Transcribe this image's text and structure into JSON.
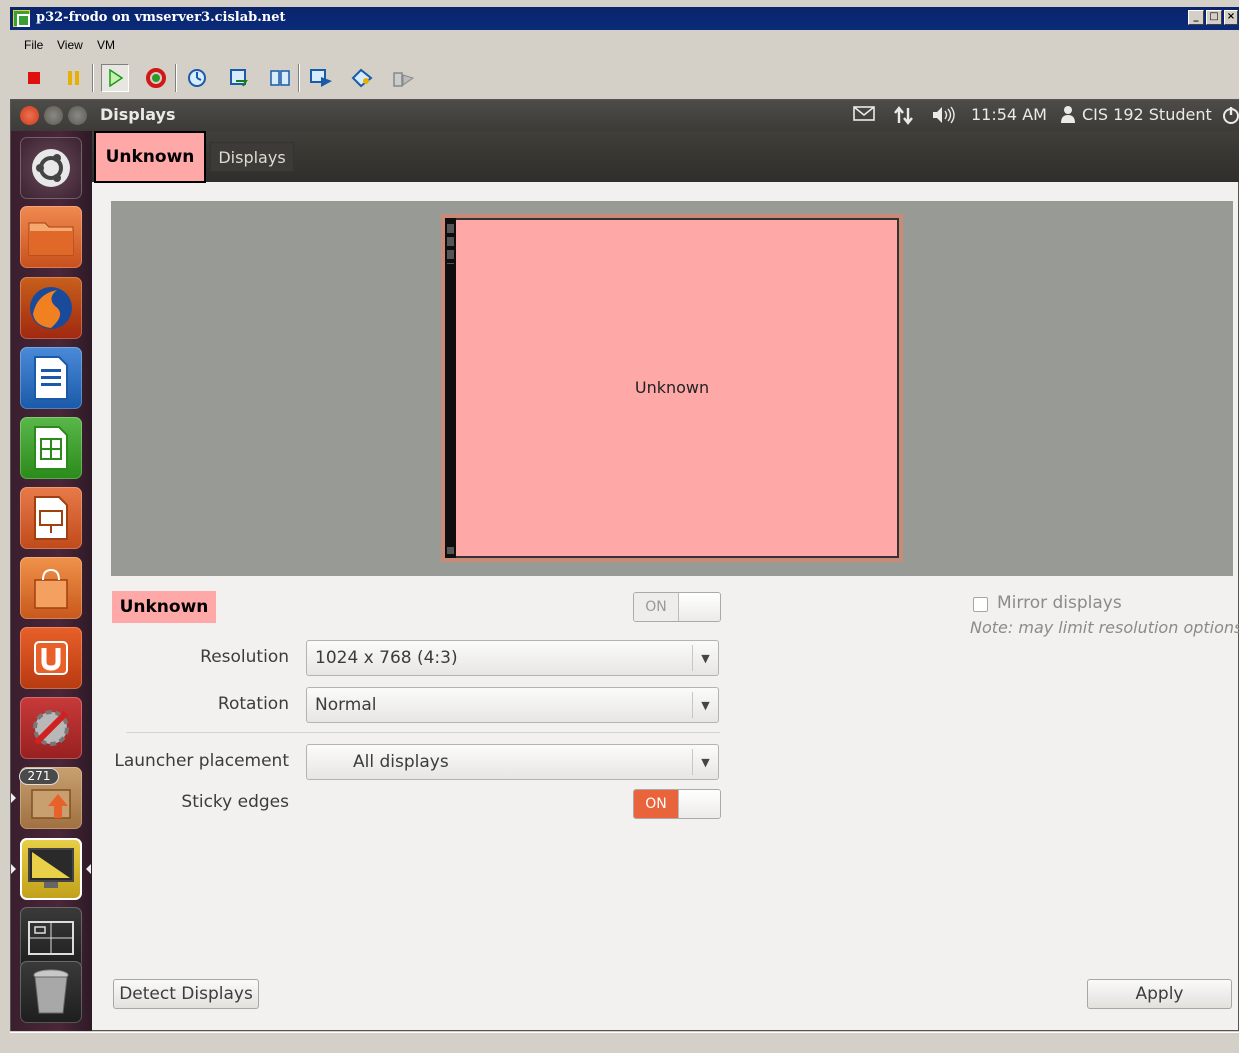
{
  "window": {
    "title": "p32-frodo on vmserver3.cislab.net"
  },
  "menubar": {
    "items": [
      "File",
      "View",
      "VM"
    ]
  },
  "toolbar": {
    "buttons": [
      "power-off",
      "suspend",
      "power-on",
      "reset",
      "snapshot",
      "revert-snapshot",
      "manage-snapshots",
      "full-screen",
      "quick-switch",
      "summary"
    ]
  },
  "guest": {
    "app_title": "Displays",
    "indicators": {
      "time": "11:54 AM",
      "user": "CIS 192 Student"
    },
    "launcher": {
      "badge_count": "271"
    },
    "tabs": [
      {
        "label": "Unknown"
      },
      {
        "label": "Displays"
      }
    ],
    "preview": {
      "monitor_label": "Unknown"
    },
    "display": {
      "name": "Unknown",
      "power_toggle": {
        "label": "ON",
        "state": "off"
      },
      "resolution_label": "Resolution",
      "resolution_value": "1024 x 768 (4:3)",
      "rotation_label": "Rotation",
      "rotation_value": "Normal"
    },
    "launcher_placement": {
      "label": "Launcher placement",
      "value": "All displays"
    },
    "sticky_edges": {
      "label": "Sticky edges",
      "toggle_label": "ON",
      "state": "on"
    },
    "mirror": {
      "label": "Mirror displays",
      "checked": false,
      "note": "Note: may limit resolution options"
    },
    "buttons": {
      "detect": "Detect Displays",
      "apply": "Apply"
    }
  },
  "colors": {
    "monitor_fill": "#ffa8a8",
    "accent_orange": "#e9643a",
    "launcher_bg": "#4a2638",
    "titlebar": "#0a246a"
  }
}
